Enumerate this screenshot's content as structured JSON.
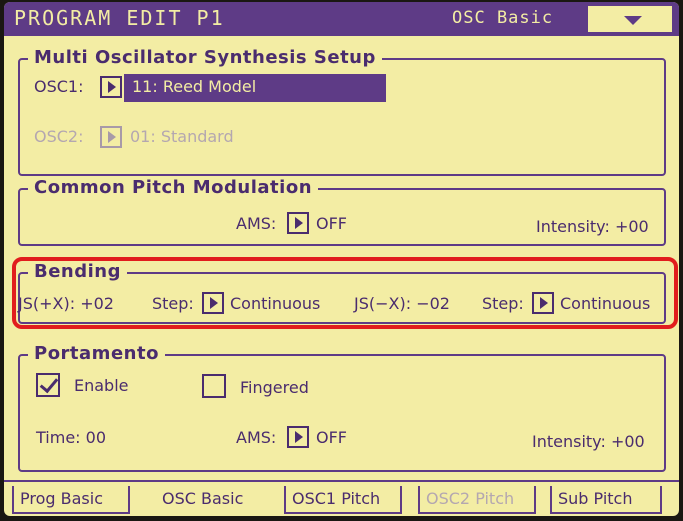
{
  "header": {
    "title": "PROGRAM EDIT P1",
    "page": "OSC Basic"
  },
  "multi_osc": {
    "title": "Multi Oscillator Synthesis Setup",
    "osc1_label": "OSC1:",
    "osc1_value": "11: Reed Model",
    "osc2_label": "OSC2:",
    "osc2_value": "01: Standard"
  },
  "common_pitch": {
    "title": "Common Pitch Modulation",
    "ams_label": "AMS:",
    "ams_value": "OFF",
    "intensity": "Intensity: +00"
  },
  "bending": {
    "title": "Bending",
    "jsx_plus": "JS(+X): +02",
    "step1_label": "Step:",
    "step1_value": "Continuous",
    "jsx_minus": "JS(−X): −02",
    "step2_label": "Step:",
    "step2_value": "Continuous"
  },
  "portamento": {
    "title": "Portamento",
    "enable_label": "Enable",
    "enable_checked": true,
    "fingered_label": "Fingered",
    "fingered_checked": false,
    "time": "Time: 00",
    "ams_label": "AMS:",
    "ams_value": "OFF",
    "intensity": "Intensity: +00"
  },
  "tabs": [
    {
      "label": "Prog Basic"
    },
    {
      "label": "OSC Basic"
    },
    {
      "label": "OSC1 Pitch"
    },
    {
      "label": "OSC2 Pitch"
    },
    {
      "label": "Sub Pitch"
    }
  ],
  "colors": {
    "screen_bg": "#f3eda4",
    "ink": "#5e3b86",
    "highlight": "#e11d1d"
  }
}
